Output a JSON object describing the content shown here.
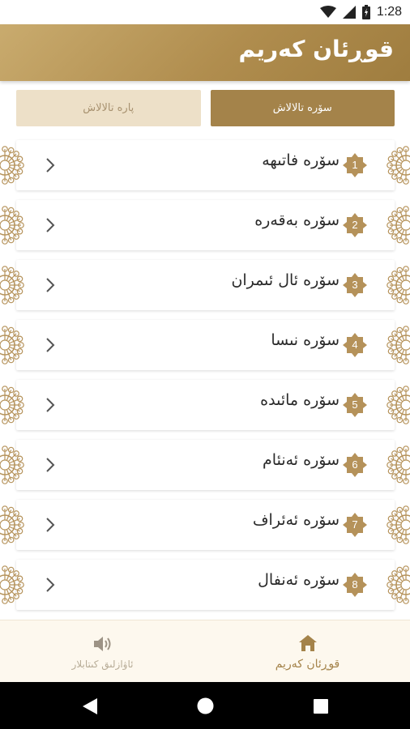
{
  "status_bar": {
    "time": "1:28"
  },
  "app_bar": {
    "title": "قوڕئان کەریم"
  },
  "tabs": [
    {
      "label": "پارە تالالاش",
      "active": false
    },
    {
      "label": "سۆرە تالالاش",
      "active": true
    }
  ],
  "surahs": [
    {
      "number": "1",
      "name": "سۆرە فاتىھە"
    },
    {
      "number": "2",
      "name": "سۆرە بەقەرە"
    },
    {
      "number": "3",
      "name": "سۆرە ئال ئىمران"
    },
    {
      "number": "4",
      "name": "سۆرە نىسا"
    },
    {
      "number": "5",
      "name": "سۆرە مائىدە"
    },
    {
      "number": "6",
      "name": "سۆرە ئەنئام"
    },
    {
      "number": "7",
      "name": "سۆرە ئەئراف"
    },
    {
      "number": "8",
      "name": "سۆرە ئەنفال"
    }
  ],
  "bottom_nav": {
    "audio_label": "ئاۋازلىق كىتابلار",
    "quran_label": "قوڕئان کەریم"
  },
  "colors": {
    "brand": "#a4834a",
    "brand_light": "#ede0c8"
  },
  "icons": {
    "audio": "speaker-icon",
    "home": "home-icon"
  }
}
